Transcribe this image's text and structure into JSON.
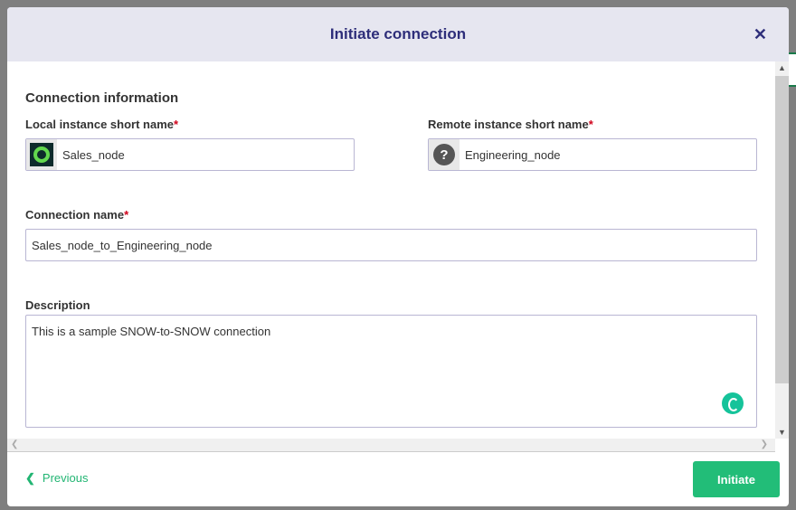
{
  "dialog": {
    "title": "Initiate connection",
    "close_icon": "close-icon"
  },
  "form": {
    "section_title": "Connection information",
    "local_label": "Local instance short name",
    "local_value": "Sales_node",
    "remote_label": "Remote instance short name",
    "remote_value": "Engineering_node",
    "connection_label": "Connection name",
    "connection_value": "Sales_node_to_Engineering_node",
    "description_label": "Description",
    "description_value": "This is a sample SNOW-to-SNOW connection",
    "required_mark": "*"
  },
  "footer": {
    "previous_label": "Previous",
    "initiate_label": "Initiate"
  },
  "colors": {
    "accent": "#22bd78",
    "title": "#2e2e7a",
    "required": "#d0021b"
  }
}
